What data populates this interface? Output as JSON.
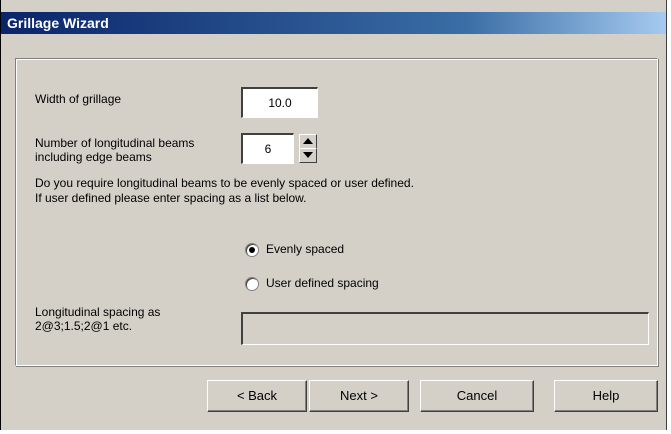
{
  "window": {
    "title": "Grillage Wizard"
  },
  "form": {
    "width_label": "Width of grillage",
    "width_value": "10.0",
    "beams_label_line1": "Number of longitudinal beams",
    "beams_label_line2": "including edge beams",
    "beams_value": "6",
    "question_line1": "Do you require longitudinal beams to be evenly spaced or user defined.",
    "question_line2": "If user defined please enter spacing as a list below.",
    "options": [
      {
        "label": "Evenly spaced",
        "selected": true
      },
      {
        "label": "User defined spacing",
        "selected": false
      }
    ],
    "spacing_label_line1": "Longitudinal spacing as",
    "spacing_label_line2": "2@3;1.5;2@1 etc.",
    "spacing_value": ""
  },
  "buttons": {
    "back": "< Back",
    "next": "Next >",
    "cancel": "Cancel",
    "help": "Help"
  }
}
